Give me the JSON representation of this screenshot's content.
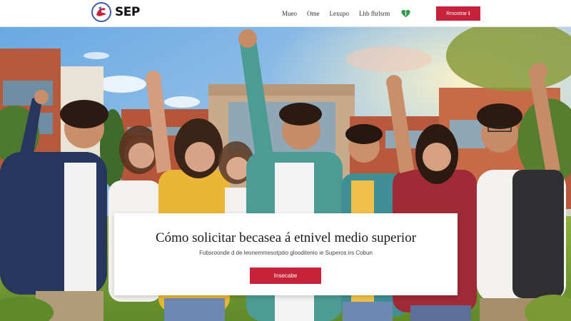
{
  "header": {
    "brand": "SEP",
    "nav": [
      "Mueo",
      "Ome",
      "Lexupo",
      "Lhb fhrlsrm"
    ],
    "cta_label": "Rmostrar ℹ"
  },
  "hero": {
    "title": "Cómo solicitar becasea á etnivel medio superior",
    "subtitle": "Fubsroonde d de leonemmesotjstio glooditenio ie Superos irs Cobun",
    "button_label": "Insecabe"
  },
  "icons": {
    "logo": "sep-logo-icon",
    "heart": "heart-icon"
  },
  "colors": {
    "accent": "#c6223a",
    "nav_text": "#333333",
    "heart_green": "#2e9a4b"
  }
}
